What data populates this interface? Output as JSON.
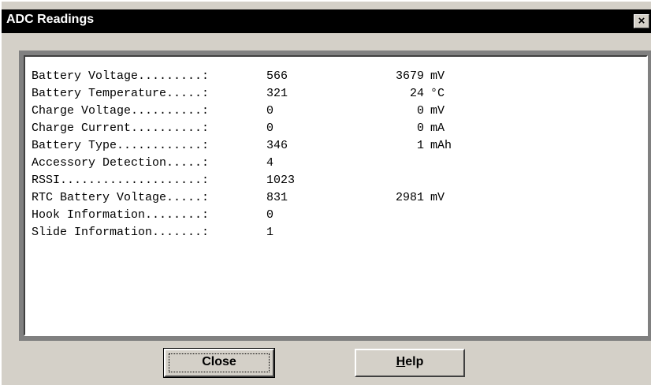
{
  "window": {
    "title": "ADC Readings",
    "close_glyph": "×",
    "close_icon": "close-icon"
  },
  "readings": [
    {
      "label": "Battery Voltage.........:",
      "raw": "566",
      "value": "3679",
      "unit": "mV"
    },
    {
      "label": "Battery Temperature.....:",
      "raw": "321",
      "value": "24",
      "unit": "°C"
    },
    {
      "label": "Charge Voltage..........:",
      "raw": "0",
      "value": "0",
      "unit": "mV"
    },
    {
      "label": "Charge Current..........:",
      "raw": "0",
      "value": "0",
      "unit": "mA"
    },
    {
      "label": "Battery Type............:",
      "raw": "346",
      "value": "1",
      "unit": "mAh"
    },
    {
      "label": "Accessory Detection.....:",
      "raw": "4",
      "value": "",
      "unit": ""
    },
    {
      "label": "RSSI....................:",
      "raw": "1023",
      "value": "",
      "unit": ""
    },
    {
      "label": "RTC Battery Voltage.....:",
      "raw": "831",
      "value": "2981",
      "unit": "mV"
    },
    {
      "label": "Hook Information........:",
      "raw": "0",
      "value": "",
      "unit": ""
    },
    {
      "label": "Slide Information.......:",
      "raw": "1",
      "value": "",
      "unit": ""
    }
  ],
  "buttons": {
    "close_label": "Close",
    "help_mnemonic": "H",
    "help_rest": "elp"
  }
}
